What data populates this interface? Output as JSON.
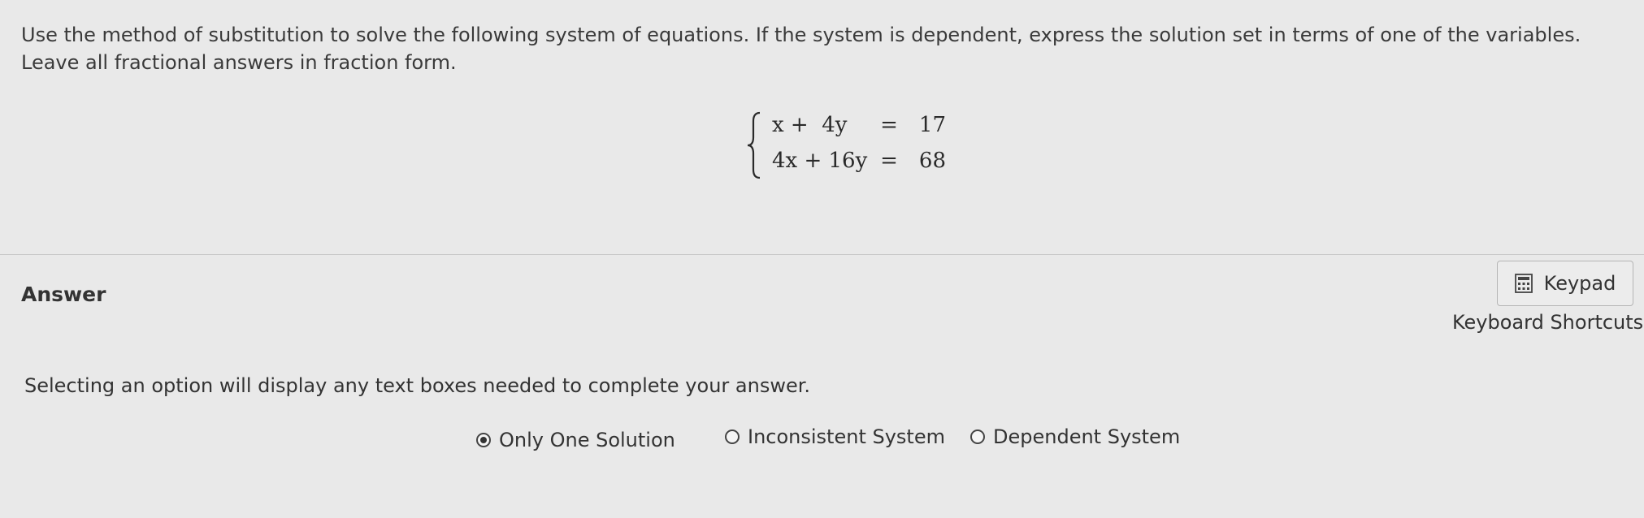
{
  "question": {
    "text": "Use the method of substitution to solve the following system of equations. If the system is dependent, express the solution set in terms of one of the variables. Leave all fractional answers in fraction form."
  },
  "system": {
    "equations": [
      {
        "lhs": "x +  4y",
        "op": "=",
        "rhs": "17"
      },
      {
        "lhs": "4x + 16y",
        "op": "=",
        "rhs": "68"
      }
    ]
  },
  "answer": {
    "label": "Answer",
    "keypad_label": "Keypad",
    "shortcuts_label": "Keyboard Shortcuts",
    "instruction": "Selecting an option will display any text boxes needed to complete your answer.",
    "options": [
      {
        "label": "Only One Solution",
        "selected": true
      },
      {
        "label": "Inconsistent System",
        "selected": false
      },
      {
        "label": "Dependent System",
        "selected": false
      }
    ]
  },
  "icons": {
    "keypad": "calculator-icon",
    "radio": "radio-button-icon"
  },
  "colors": {
    "background": "#e9e9e9",
    "text": "#333333",
    "divider": "#c9c9c9"
  }
}
